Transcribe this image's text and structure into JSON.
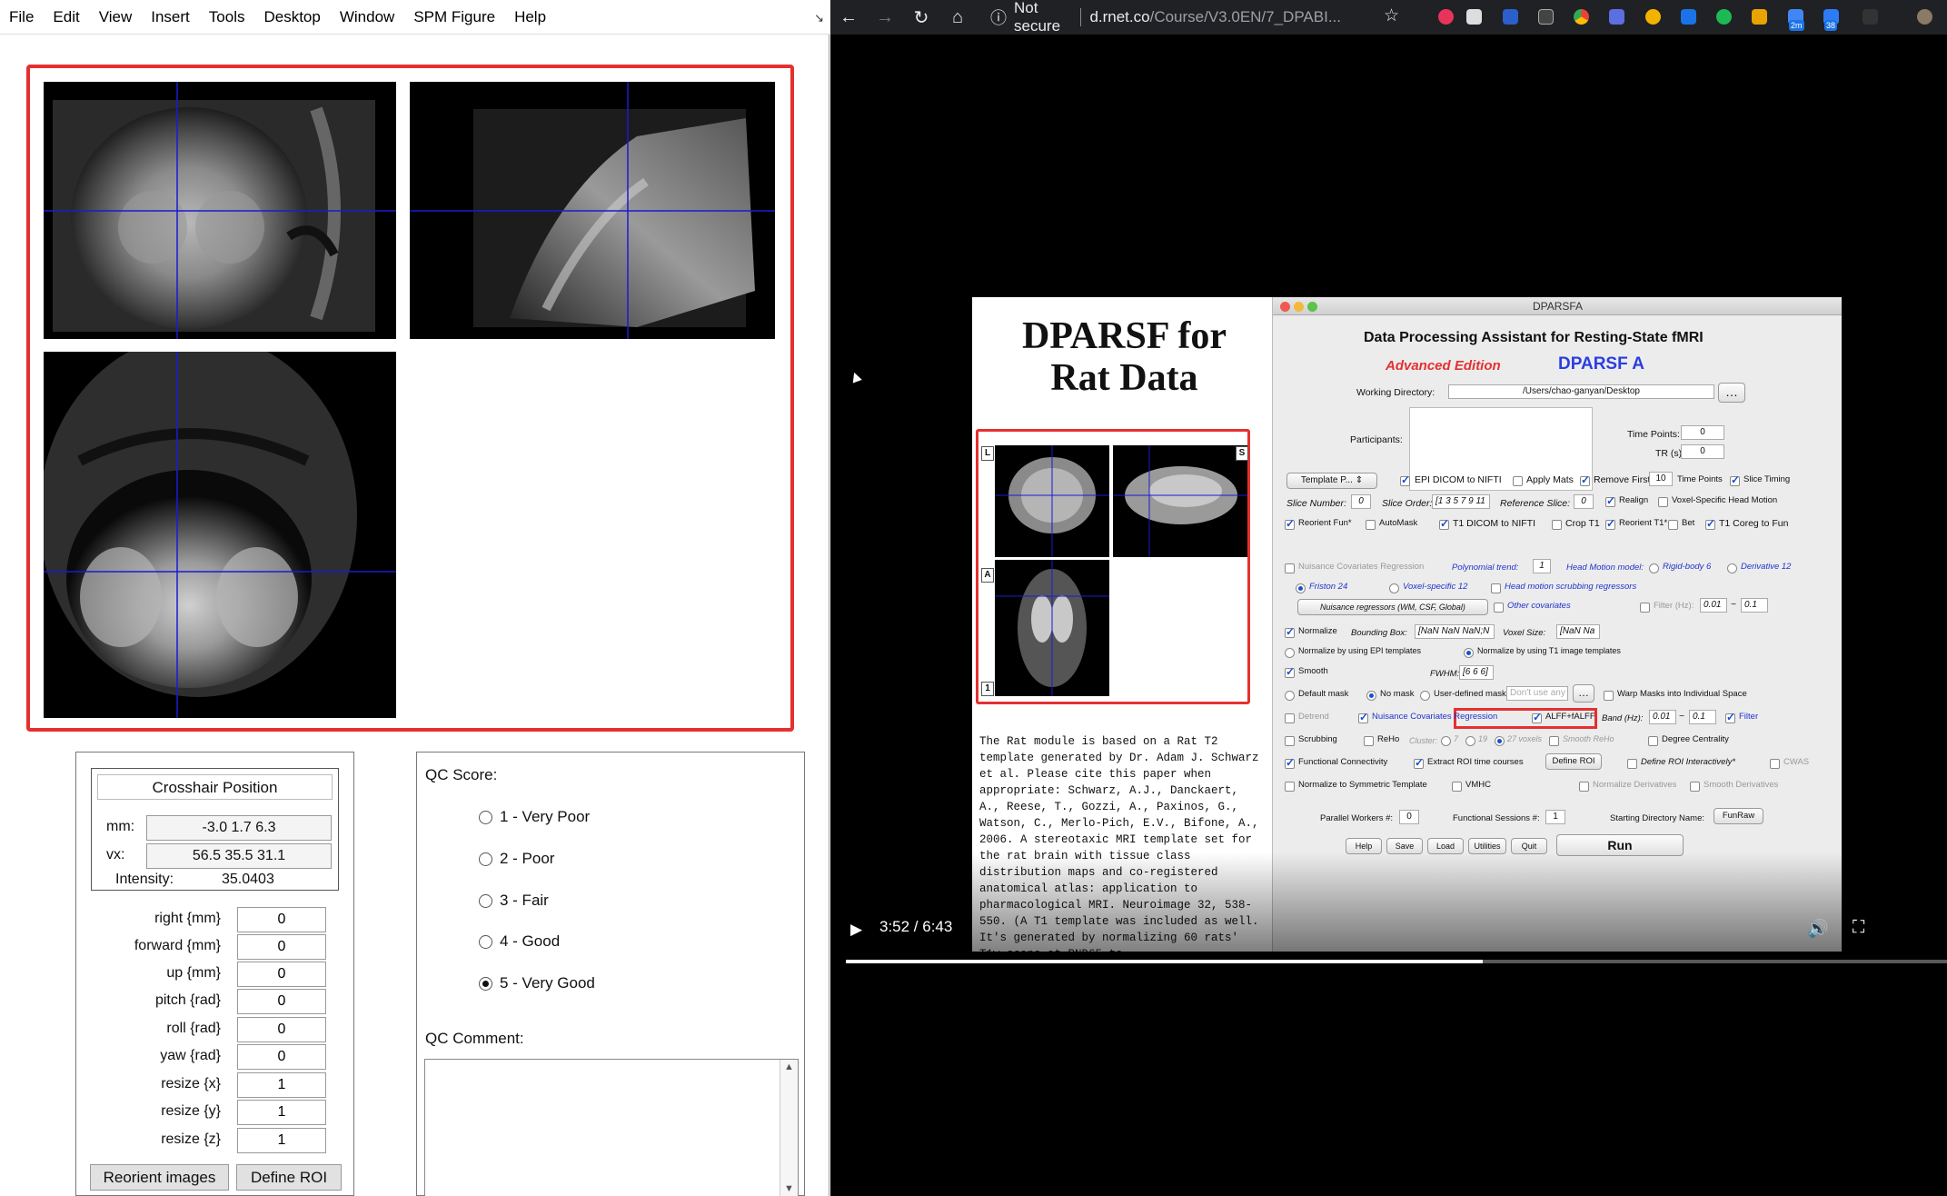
{
  "spm": {
    "menu": [
      "File",
      "Edit",
      "View",
      "Insert",
      "Tools",
      "Desktop",
      "Window",
      "SPM Figure",
      "Help"
    ],
    "crosshair": {
      "title": "Crosshair Position",
      "mm_label": "mm:",
      "mm_value": "-3.0 1.7 6.3",
      "vx_label": "vx:",
      "vx_value": "56.5 35.5 31.1",
      "intensity_label": "Intensity:",
      "intensity_value": "35.0403"
    },
    "params": [
      {
        "label": "right  {mm}",
        "value": "0"
      },
      {
        "label": "forward  {mm}",
        "value": "0"
      },
      {
        "label": "up  {mm}",
        "value": "0"
      },
      {
        "label": "pitch  {rad}",
        "value": "0"
      },
      {
        "label": "roll  {rad}",
        "value": "0"
      },
      {
        "label": "yaw  {rad}",
        "value": "0"
      },
      {
        "label": "resize  {x}",
        "value": "1"
      },
      {
        "label": "resize  {y}",
        "value": "1"
      },
      {
        "label": "resize  {z}",
        "value": "1"
      }
    ],
    "buttons": {
      "reorient": "Reorient images",
      "define_roi": "Define ROI"
    },
    "qc": {
      "score_label": "QC Score:",
      "options": [
        "1 - Very Poor",
        "2 - Poor",
        "3 - Fair",
        "4 - Good",
        "5 - Very Good"
      ],
      "selected_index": 4,
      "comment_label": "QC Comment:",
      "comment_value": ""
    }
  },
  "browser": {
    "security": "Not secure",
    "url_host": "d.rnet.co",
    "url_path": "/Course/V3.0EN/7_DPABI...",
    "badges": [
      "2m",
      "38"
    ],
    "video": {
      "time": "3:52 / 6:43",
      "progress_fraction": 0.578
    }
  },
  "slide": {
    "title_line1": "DPARSF for",
    "title_line2": "Rat Data",
    "tags": [
      "L",
      "S",
      "A",
      "1"
    ],
    "body": "The Rat module is based on a Rat T2 template generated by Dr. Adam J. Schwarz et al. Please cite this paper when appropriate: Schwarz, A.J., Danckaert, A., Reese, T., Gozzi, A., Paxinos, G., Watson, C., Merlo-Pich, E.V., Bifone, A., 2006. A stereotaxic MRI template set for the rat brain with tissue class distribution maps and co-registered anatomical atlas: application to pharmacological MRI. Neuroimage 32, 538-550. (A T1 template was included as well. It's generated by normalizing 60 rats' T1w scans at PND65 to"
  },
  "dparsfa": {
    "window_title": "DPARSFA",
    "heading": "Data Processing Assistant for Resting-State fMRI",
    "edition": "Advanced Edition",
    "logo": "DPARSF A",
    "working_dir_label": "Working Directory:",
    "working_dir_value": "/Users/chao-ganyan/Desktop",
    "participants_label": "Participants:",
    "time_points_label": "Time Points:",
    "time_points_value": "0",
    "tr_label": "TR (s):",
    "tr_value": "0",
    "template_label": "Template P...",
    "epi_dicom": "EPI DICOM to NIFTI",
    "apply_mats": "Apply Mats",
    "remove_first": "Remove First",
    "remove_first_value": "10",
    "time_points_short": "Time Points",
    "slice_timing": "Slice Timing",
    "slice_number_label": "Slice Number:",
    "slice_number_value": "0",
    "slice_order_label": "Slice Order:",
    "slice_order_value": "[1 3 5 7 9 11",
    "reference_slice_label": "Reference Slice:",
    "reference_slice_value": "0",
    "realign": "Realign",
    "voxel_head_motion": "Voxel-Specific Head Motion",
    "reorient_fun": "Reorient Fun*",
    "automask": "AutoMask",
    "t1_dicom": "T1 DICOM to NIFTI",
    "crop_t1": "Crop T1",
    "reorient_t1": "Reorient T1*",
    "bet": "Bet",
    "t1_coreg": "T1 Coreg to Fun",
    "nuisance_regression": "Nuisance Covariates Regression",
    "polynomial_trend_label": "Polynomial trend:",
    "polynomial_trend_value": "1",
    "head_motion_model": "Head Motion model:",
    "rigid_body": "Rigid-body 6",
    "derivative": "Derivative 12",
    "friston": "Friston 24",
    "voxel_specific": "Voxel-specific 12",
    "head_motion_scrubbing": "Head motion scrubbing regressors",
    "nuisance_button": "Nuisance regressors (WM, CSF, Global)",
    "other_covariates": "Other covariates",
    "filter_label": "Filter (Hz):",
    "filter_low": "0.01",
    "filter_high": "0.1",
    "normalize": "Normalize",
    "bounding_box_label": "Bounding Box:",
    "bounding_box_value": "[NaN NaN NaN;N",
    "voxel_size_label": "Voxel Size:",
    "voxel_size_value": "[NaN Na",
    "normalize_epi": "Normalize by using EPI templates",
    "normalize_t1": "Normalize by using T1 image templates",
    "smooth": "Smooth",
    "fwhm_label": "FWHM:",
    "fwhm_value": "[6 6 6]",
    "default_mask": "Default mask",
    "no_mask": "No mask",
    "user_mask": "User-defined mask",
    "dont_use_mask": "Don't use any Mas",
    "warp_masks": "Warp Masks into Individual Space",
    "detrend": "Detrend",
    "nuisance_covariates_regression": "Nuisance Covariates Regression",
    "alff": "ALFF+fALFF",
    "band_label": "Band (Hz):",
    "band_low": "0.01",
    "band_high": "0.1",
    "filter": "Filter",
    "scrubbing": "Scrubbing",
    "reho": "ReHo",
    "cluster": "Cluster:",
    "reho_7": "7",
    "reho_19": "19",
    "reho_27": "27 voxels",
    "smooth_reho": "Smooth ReHo",
    "degree_centrality": "Degree Centrality",
    "functional_connectivity": "Functional Connectivity",
    "extract_roi": "Extract ROI time courses",
    "define_roi": "Define ROI",
    "define_roi_interactively": "Define ROI Interactively*",
    "cwas": "CWAS",
    "normalize_symmetric": "Normalize to Symmetric Template",
    "vmhc": "VMHC",
    "normalize_derivatives": "Normalize Derivatives",
    "smooth_derivatives": "Smooth Derivatives",
    "parallel_workers_label": "Parallel Workers #:",
    "parallel_workers_value": "0",
    "functional_sessions_label": "Functional Sessions #:",
    "functional_sessions_value": "1",
    "starting_dir_label": "Starting Directory Name:",
    "starting_dir_value": "FunRaw",
    "bottom_buttons": [
      "Help",
      "Save",
      "Load",
      "Utilities",
      "Quit"
    ],
    "run": "Run"
  }
}
